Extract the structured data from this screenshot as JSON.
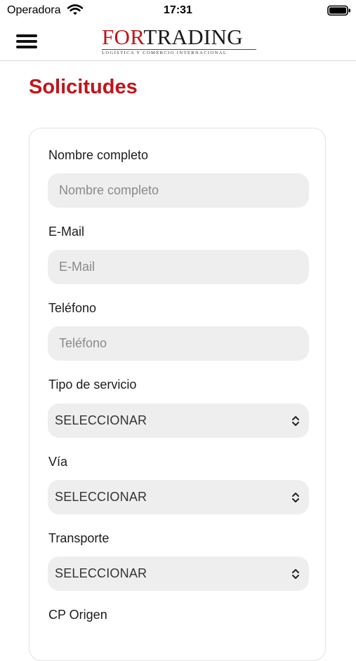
{
  "status_bar": {
    "carrier": "Operadora",
    "time": "17:31"
  },
  "app_bar": {
    "menu_icon": "hamburger-menu-icon",
    "logo_part_1": "FOR",
    "logo_part_2": "TRADING",
    "logo_tagline": "LOGÍSTICA Y COMERCIO INTERNACIONAL"
  },
  "page": {
    "title": "Solicitudes"
  },
  "form": {
    "fields": [
      {
        "label": "Nombre completo",
        "placeholder": "Nombre completo"
      },
      {
        "label": "E-Mail",
        "placeholder": "E-Mail"
      },
      {
        "label": "Teléfono",
        "placeholder": "Teléfono"
      },
      {
        "label": "Tipo de servicio",
        "value": "SELECCIONAR"
      },
      {
        "label": "Vía",
        "value": "SELECCIONAR"
      },
      {
        "label": "Transporte",
        "value": "SELECCIONAR"
      },
      {
        "label": "CP Origen"
      }
    ]
  },
  "colors": {
    "brand_red": "#c0151b",
    "input_background": "#eeeeee"
  }
}
